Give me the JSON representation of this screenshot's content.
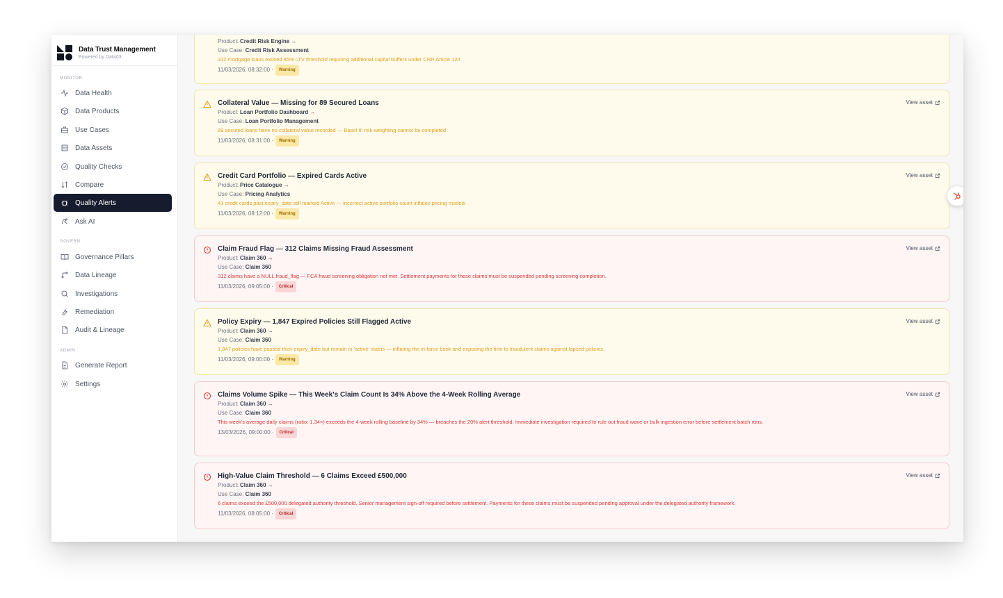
{
  "app": {
    "title": "Data Trust Management",
    "subtitle": "Powered by Data03"
  },
  "sidebar": {
    "sections": [
      {
        "label": "MONITOR",
        "items": [
          {
            "label": "Data Health",
            "icon": "activity-icon"
          },
          {
            "label": "Data Products",
            "icon": "box-icon"
          },
          {
            "label": "Use Cases",
            "icon": "briefcase-icon"
          },
          {
            "label": "Data Assets",
            "icon": "database-icon"
          },
          {
            "label": "Quality Checks",
            "icon": "check-circle-icon"
          },
          {
            "label": "Compare",
            "icon": "compare-icon"
          },
          {
            "label": "Quality Alerts",
            "icon": "bug-icon",
            "active": true
          },
          {
            "label": "Ask AI",
            "icon": "ai-icon"
          }
        ]
      },
      {
        "label": "GOVERN",
        "items": [
          {
            "label": "Governance Pillars",
            "icon": "book-icon"
          },
          {
            "label": "Data Lineage",
            "icon": "lineage-icon"
          },
          {
            "label": "Investigations",
            "icon": "search-icon"
          },
          {
            "label": "Remediation",
            "icon": "wrench-icon"
          },
          {
            "label": "Audit & Lineage",
            "icon": "file-icon"
          }
        ]
      },
      {
        "label": "ADMIN",
        "items": [
          {
            "label": "Generate Report",
            "icon": "report-icon"
          },
          {
            "label": "Settings",
            "icon": "gear-icon"
          }
        ]
      }
    ]
  },
  "alerts": [
    {
      "severity": "warning",
      "title": "",
      "product_label": "Product:",
      "product": "Credit Risk Engine →",
      "usecase_label": "Use Case:",
      "usecase": "Credit Risk Assessment",
      "description": "312 mortgage loans exceed 85% LTV threshold requiring additional capital buffers under CRR Article 124",
      "timestamp": "11/03/2026, 08:32:00 ·",
      "badge": "Warning",
      "view_label": ""
    },
    {
      "severity": "warning",
      "title": "Collateral Value — Missing for 89 Secured Loans",
      "product_label": "Product:",
      "product": "Loan Portfolio Dashboard →",
      "usecase_label": "Use Case:",
      "usecase": "Loan Portfolio Management",
      "description": "89 secured loans have no collateral value recorded — Basel III risk-weighting cannot be completed",
      "timestamp": "11/03/2026, 08:31:00 ·",
      "badge": "Warning",
      "view_label": "View asset"
    },
    {
      "severity": "warning",
      "title": "Credit Card Portfolio — Expired Cards Active",
      "product_label": "Product:",
      "product": "Price Catalogue →",
      "usecase_label": "Use Case:",
      "usecase": "Pricing Analytics",
      "description": "41 credit cards past expiry_date still marked Active — incorrect active portfolio count inflates pricing models",
      "timestamp": "11/03/2026, 08:12:00 ·",
      "badge": "Warning",
      "view_label": "View asset"
    },
    {
      "severity": "critical",
      "title": "Claim Fraud Flag — 312 Claims Missing Fraud Assessment",
      "product_label": "Product:",
      "product": "Claim 360 →",
      "usecase_label": "Use Case:",
      "usecase": "Claim 360",
      "description": "312 claims have a NULL fraud_flag — FCA fraud screening obligation not met. Settlement payments for these claims must be suspended pending screening completion.",
      "timestamp": "11/03/2026, 09:05:00 ·",
      "badge": "Critical",
      "view_label": "View asset"
    },
    {
      "severity": "warning",
      "title": "Policy Expiry — 1,847 Expired Policies Still Flagged Active",
      "product_label": "Product:",
      "product": "Claim 360 →",
      "usecase_label": "Use Case:",
      "usecase": "Claim 360",
      "description": "1,847 policies have passed their expiry_date but remain in 'active' status — inflating the in-force book and exposing the firm to fraudulent claims against lapsed policies.",
      "timestamp": "11/03/2026, 09:00:00 ·",
      "badge": "Warning",
      "view_label": "View asset"
    },
    {
      "severity": "critical",
      "title": "Claims Volume Spike — This Week's Claim Count Is 34% Above the 4-Week Rolling Average",
      "product_label": "Product:",
      "product": "Claim 360 →",
      "usecase_label": "Use Case:",
      "usecase": "Claim 360",
      "description": "This week's average daily claims (ratio: 1.34×) exceeds the 4-week rolling baseline by 34% — breaches the 20% alert threshold. Immediate investigation required to rule out fraud wave or bulk ingestion error before settlement batch runs.",
      "timestamp": "13/03/2026, 09:00:00 ·",
      "badge": "Critical",
      "view_label": "View asset"
    },
    {
      "severity": "critical",
      "title": "High-Value Claim Threshold — 6 Claims Exceed £500,000",
      "product_label": "Product:",
      "product": "Claim 360 →",
      "usecase_label": "Use Case:",
      "usecase": "Claim 360",
      "description": "6 claims exceed the £500,000 delegated authority threshold. Senior management sign-off required before settlement. Payments for these claims must be suspended pending approval under the delegated authority framework.",
      "timestamp": "11/03/2026, 08:05:00 ·",
      "badge": "Critical",
      "view_label": "View asset"
    }
  ],
  "colors": {
    "warning_bg": "#fffbec",
    "warning_text": "#e0a020",
    "critical_bg": "#fff5f5",
    "critical_text": "#dc3a3a",
    "active_nav": "#171b2e"
  }
}
